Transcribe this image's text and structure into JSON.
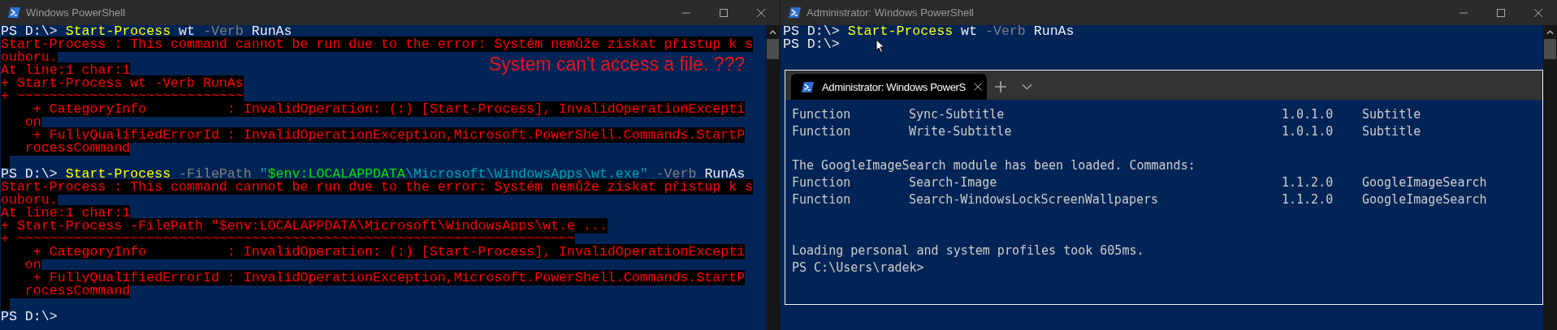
{
  "left_window": {
    "title": "Windows PowerShell",
    "lines": [
      {
        "kind": "input",
        "segments": [
          {
            "kind": "prompt",
            "text": "PS D:\\> "
          },
          {
            "kind": "command",
            "text": "Start-Process"
          },
          {
            "kind": "argument",
            "text": " wt "
          },
          {
            "kind": "parameter",
            "text": "-Verb"
          },
          {
            "kind": "argument",
            "text": " RunAs"
          }
        ]
      },
      {
        "kind": "error",
        "text": "Start-Process : This command cannot be run due to the error: Systém nemůže získat přístup k s"
      },
      {
        "kind": "error",
        "text": "ouboru."
      },
      {
        "kind": "error",
        "text": "At line:1 char:1"
      },
      {
        "kind": "error",
        "text": "+ Start-Process wt -Verb RunAs"
      },
      {
        "kind": "error",
        "text": "+ ~~~~~~~~~~~~~~~~~~~~~~~~~~~~"
      },
      {
        "kind": "error",
        "text": "    + CategoryInfo          : InvalidOperation: (:) [Start-Process], InvalidOperationExcepti"
      },
      {
        "kind": "error",
        "text": "   on"
      },
      {
        "kind": "error",
        "text": "    + FullyQualifiedErrorId : InvalidOperationException,Microsoft.PowerShell.Commands.StartP"
      },
      {
        "kind": "error",
        "text": "   rocessCommand"
      },
      {
        "kind": "error-gap"
      },
      {
        "kind": "input",
        "segments": [
          {
            "kind": "prompt",
            "text": "PS D:\\> "
          },
          {
            "kind": "command",
            "text": "Start-Process"
          },
          {
            "kind": "parameter",
            "text": " -FilePath "
          },
          {
            "kind": "string",
            "text": "\""
          },
          {
            "kind": "variable",
            "text": "$env:LOCALAPPDATA"
          },
          {
            "kind": "string",
            "text": "\\Microsoft\\WindowsApps\\wt.exe\""
          },
          {
            "kind": "parameter",
            "text": " -Verb"
          },
          {
            "kind": "argument",
            "text": " RunAs"
          }
        ]
      },
      {
        "kind": "error",
        "text": "Start-Process : This command cannot be run due to the error: Systém nemůže získat přístup k s"
      },
      {
        "kind": "error",
        "text": "ouboru."
      },
      {
        "kind": "error",
        "text": "At line:1 char:1"
      },
      {
        "kind": "error",
        "text": "+ Start-Process -FilePath \"$env:LOCALAPPDATA\\Microsoft\\WindowsApps\\wt.e ..."
      },
      {
        "kind": "error",
        "text": "+ ~~~~~~~~~~~~~~~~~~~~~~~~~~~~~~~~~~~~~~~~~~~~~~~~~~~~~~~~~~~~~~~~~~~~~"
      },
      {
        "kind": "error",
        "text": "    + CategoryInfo          : InvalidOperation: (:) [Start-Process], InvalidOperationExcepti"
      },
      {
        "kind": "error",
        "text": "   on"
      },
      {
        "kind": "error",
        "text": "    + FullyQualifiedErrorId : InvalidOperationException,Microsoft.PowerShell.Commands.StartP"
      },
      {
        "kind": "error",
        "text": "   rocessCommand"
      },
      {
        "kind": "error-gap"
      },
      {
        "kind": "input",
        "segments": [
          {
            "kind": "prompt",
            "text": "PS D:\\>"
          }
        ]
      }
    ],
    "annotation": "System can't access a file. ???"
  },
  "right_window": {
    "title": "Administrator: Windows PowerShell",
    "lines": [
      {
        "kind": "input",
        "segments": [
          {
            "kind": "prompt",
            "text": "PS D:\\> "
          },
          {
            "kind": "command",
            "text": "Start-Process"
          },
          {
            "kind": "argument",
            "text": " wt "
          },
          {
            "kind": "parameter",
            "text": "-Verb"
          },
          {
            "kind": "argument",
            "text": " RunAs"
          }
        ]
      },
      {
        "kind": "input",
        "segments": [
          {
            "kind": "prompt",
            "text": "PS D:\\>"
          }
        ]
      }
    ],
    "terminal": {
      "tab": {
        "title": "Administrator: Windows PowerS",
        "selected": true
      },
      "lines": [
        {
          "kind": "row",
          "cells": [
            "Function",
            "Sync-Subtitle",
            "1.0.1.0",
            "Subtitle"
          ]
        },
        {
          "kind": "row",
          "cells": [
            "Function",
            "Write-Subtitle",
            "1.0.1.0",
            "Subtitle"
          ]
        },
        {
          "kind": "blank"
        },
        {
          "kind": "text",
          "text": "The GoogleImageSearch module has been loaded. Commands:"
        },
        {
          "kind": "row",
          "cells": [
            "Function",
            "Search-Image",
            "1.1.2.0",
            "GoogleImageSearch"
          ]
        },
        {
          "kind": "row",
          "cells": [
            "Function",
            "Search-WindowsLockScreenWallpapers",
            "1.1.2.0",
            "GoogleImageSearch"
          ]
        },
        {
          "kind": "blank"
        },
        {
          "kind": "blank"
        },
        {
          "kind": "text",
          "text": "Loading personal and system profiles took 605ms."
        },
        {
          "kind": "text",
          "text": "PS C:\\Users\\radek>"
        }
      ]
    }
  }
}
